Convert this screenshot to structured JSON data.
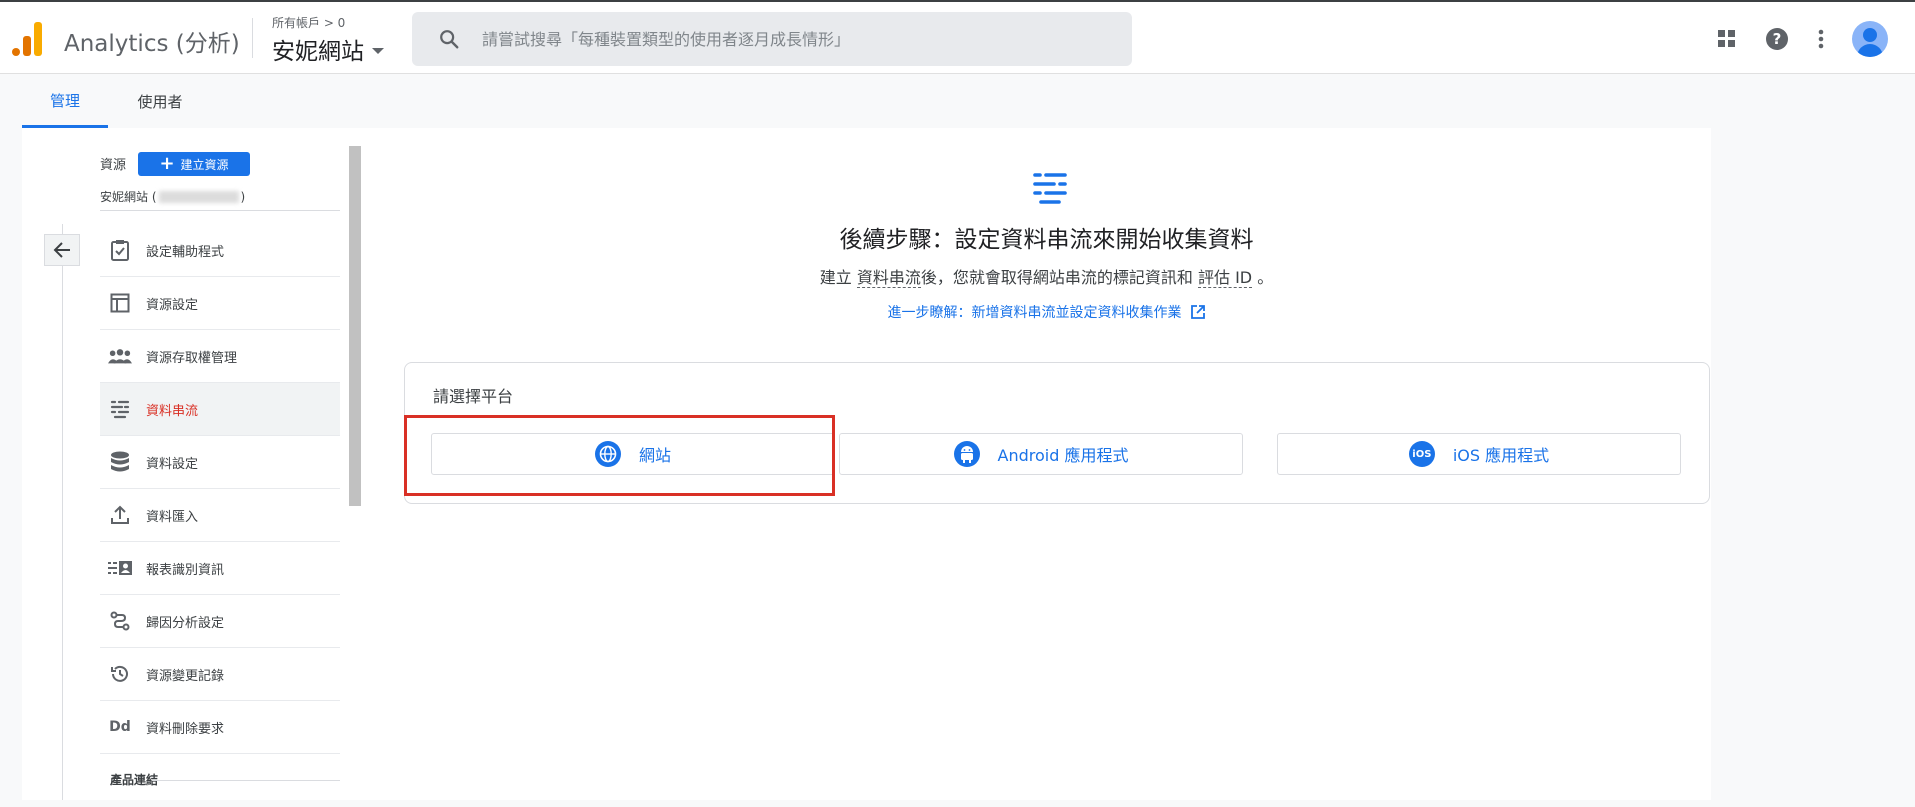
{
  "header": {
    "app_title": "Analytics (分析)",
    "breadcrumb": "所有帳戶 > 0",
    "property_name": "安妮網站",
    "search_placeholder": "請嘗試搜尋「每種裝置類型的使用者逐月成長情形」"
  },
  "tabs": [
    {
      "label": "管理",
      "active": true
    },
    {
      "label": "使用者",
      "active": false
    }
  ],
  "sidebar": {
    "resource_label": "資源",
    "create_button": "建立資源",
    "property_prefix": "安妮網站 (",
    "property_suffix": ")",
    "items": [
      {
        "label": "設定輔助程式",
        "icon": "clipboard-check-icon"
      },
      {
        "label": "資源設定",
        "icon": "layout-icon"
      },
      {
        "label": "資源存取權管理",
        "icon": "people-icon"
      },
      {
        "label": "資料串流",
        "icon": "data-streams-icon",
        "selected": true
      },
      {
        "label": "資料設定",
        "icon": "database-icon"
      },
      {
        "label": "資料匯入",
        "icon": "upload-icon"
      },
      {
        "label": "報表識別資訊",
        "icon": "reporting-identity-icon"
      },
      {
        "label": "歸因分析設定",
        "icon": "attribution-icon"
      },
      {
        "label": "資源變更記錄",
        "icon": "history-icon"
      },
      {
        "label": "資料刪除要求",
        "icon": "dd-icon",
        "icon_text": "Dd"
      }
    ],
    "section_product_links": "產品連結"
  },
  "main": {
    "title": "後續步驟：設定資料串流來開始收集資料",
    "subtitle_1": "建立 ",
    "subtitle_term1": "資料串流",
    "subtitle_2": "後，您就會取得網站串流的標記資訊和 ",
    "subtitle_term2": "評估 ID",
    "subtitle_3": " 。",
    "learn_more": "進一步瞭解：新增資料串流並設定資料收集作業",
    "platform_title": "請選擇平台",
    "platforms": [
      {
        "label": "網站",
        "icon": "globe-icon"
      },
      {
        "label": "Android 應用程式",
        "icon": "android-icon"
      },
      {
        "label": "iOS 應用程式",
        "icon": "ios-icon",
        "icon_text": "iOS"
      }
    ]
  },
  "colors": {
    "accent": "#1a73e8",
    "selected_text": "#d93025",
    "highlight_box": "#d93025"
  }
}
